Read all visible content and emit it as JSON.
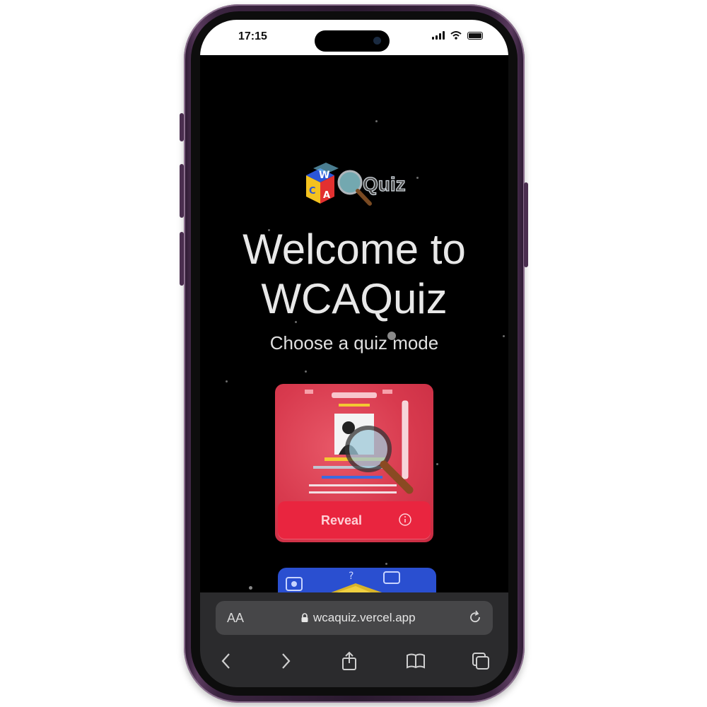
{
  "status_bar": {
    "time": "17:15"
  },
  "page": {
    "headline_line1": "Welcome to",
    "headline_line2": "WCAQuiz",
    "subtitle": "Choose a quiz mode",
    "logo_text": "Quiz"
  },
  "modes": [
    {
      "label": "Reveal",
      "color": "#e9253f"
    }
  ],
  "browser": {
    "reader_label": "AA",
    "url": "wcaquiz.vercel.app"
  },
  "icons": [
    "lock-icon",
    "reload-icon",
    "back-icon",
    "forward-icon",
    "share-icon",
    "bookmarks-icon",
    "tabs-icon",
    "info-icon",
    "magnifier-icon"
  ]
}
